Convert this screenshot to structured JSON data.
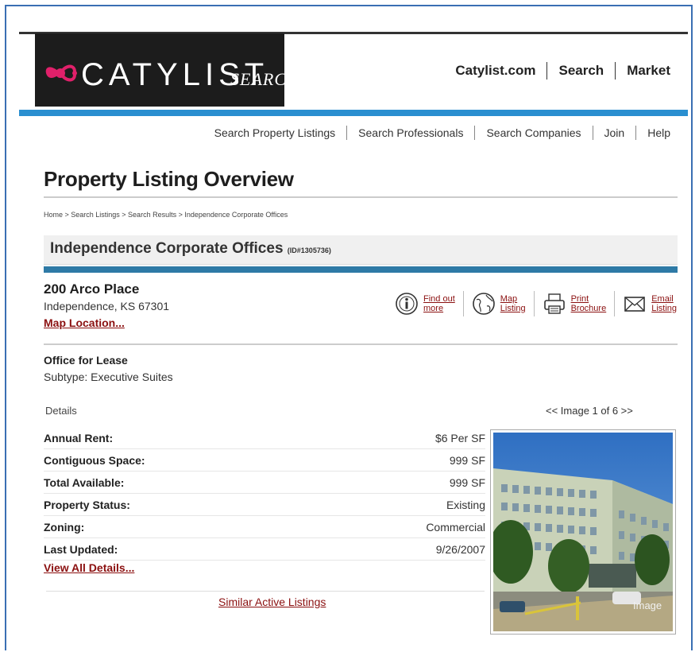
{
  "header": {
    "logo_word": "CATYLIST",
    "logo_sub": "SEARCH",
    "top_nav": [
      "Catylist.com",
      "Search",
      "Market"
    ]
  },
  "sub_nav": [
    "Search Property Listings",
    "Search Professionals",
    "Search Companies",
    "Join",
    "Help"
  ],
  "page_title": "Property Listing Overview",
  "breadcrumb": "Home > Search Listings > Search Results > Independence Corporate Offices",
  "listing": {
    "name": "Independence Corporate Offices",
    "id": "(ID#1305736)",
    "address_line1": "200 Arco Place",
    "address_line2": "Independence, KS 67301",
    "map_location_link": "Map Location...",
    "actions": [
      {
        "icon": "info-icon",
        "line1": "Find out",
        "line2": "more"
      },
      {
        "icon": "globe-icon",
        "line1": "Map",
        "line2": "Listing"
      },
      {
        "icon": "printer-icon",
        "line1": "Print",
        "line2": "Brochure"
      },
      {
        "icon": "envelope-icon",
        "line1": "Email",
        "line2": "Listing"
      }
    ],
    "type": "Office for Lease",
    "subtype": "Subtype: Executive Suites"
  },
  "details": {
    "label": "Details",
    "rows": [
      {
        "key": "Annual Rent:",
        "value": "$6 Per SF"
      },
      {
        "key": "Contiguous Space:",
        "value": "999 SF"
      },
      {
        "key": "Total Available:",
        "value": "999 SF"
      },
      {
        "key": "Property Status:",
        "value": "Existing"
      },
      {
        "key": "Zoning:",
        "value": "Commercial"
      },
      {
        "key": "Last Updated:",
        "value": "9/26/2007"
      }
    ],
    "view_all_link": "View All Details...",
    "similar_link": "Similar Active Listings"
  },
  "gallery": {
    "nav": "<< Image 1 of 6 >>",
    "photo_caption": "Image"
  },
  "colors": {
    "accent_blue": "#2a8fd0",
    "teal_bar": "#2e7aa6",
    "link_red": "#8b1010",
    "logo_mark": "#e0206a"
  }
}
